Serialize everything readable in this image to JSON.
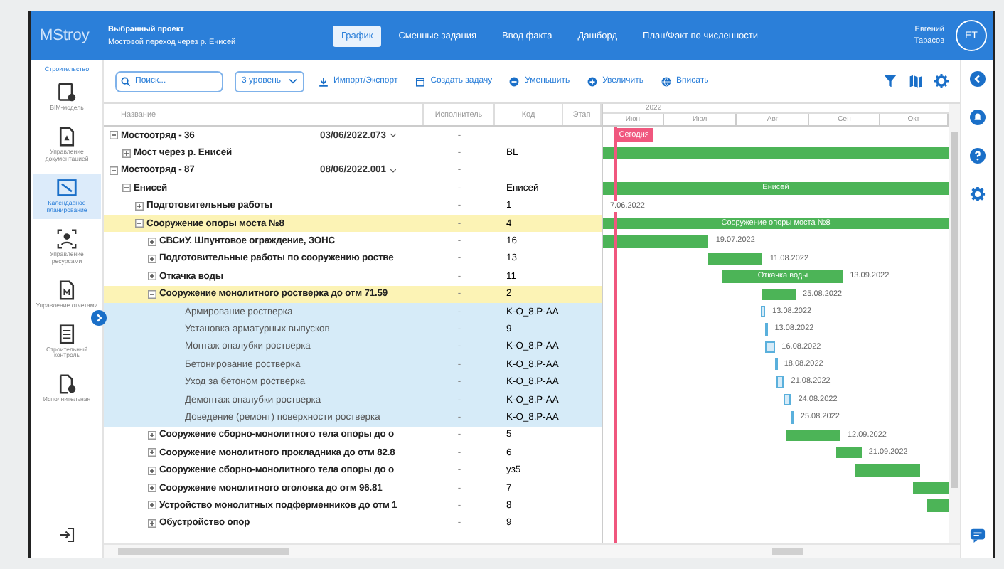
{
  "header": {
    "logo": "MStroy",
    "project_caption": "Выбранный проект",
    "project_name": "Мостовой переход через р. Енисей",
    "tabs": [
      {
        "label": "График",
        "selected": true
      },
      {
        "label": "Сменные задания",
        "selected": false
      },
      {
        "label": "Ввод факта",
        "selected": false
      },
      {
        "label": "Дашборд",
        "selected": false
      },
      {
        "label": "План/Факт по численности",
        "selected": false
      }
    ],
    "user_first": "Евгений",
    "user_last": "Тарасов",
    "avatar": "ET"
  },
  "sidebar": {
    "caption": "Строительство",
    "items": [
      {
        "kind": "model",
        "label": "BIM-модель",
        "selected": false
      },
      {
        "kind": "document",
        "label": "Управление документацией",
        "selected": false
      },
      {
        "kind": "schedule",
        "label": "Календарное планирование",
        "selected": true
      },
      {
        "kind": "resources",
        "label": "Управление ресурсами",
        "selected": false
      },
      {
        "kind": "report",
        "label": "Управление отчетами",
        "selected": false
      },
      {
        "kind": "control",
        "label": "Строительный контроль",
        "selected": false
      },
      {
        "kind": "executive",
        "label": "Исполнительная",
        "selected": false
      }
    ]
  },
  "toolbar": {
    "search": {
      "placeholder": "Поиск..."
    },
    "level_select": "3 уровень",
    "buttons": [
      {
        "kind": "import",
        "label": "Импорт/Экспорт"
      },
      {
        "kind": "create",
        "label": "Создать задачу"
      },
      {
        "kind": "zoom_out",
        "label": "Уменьшить"
      },
      {
        "kind": "zoom_in",
        "label": "Увеличить"
      },
      {
        "kind": "fit",
        "label": "Вписать"
      }
    ]
  },
  "table": {
    "columns": [
      "Название",
      "Исполнитель",
      "Код",
      "Этап"
    ],
    "rows": [
      {
        "name": "Мостоотряд - 36",
        "version": "03/06/2022.073",
        "kind": "group",
        "expanded": true,
        "executor": "-",
        "marked": false,
        "selected": false,
        "children": [
          {
            "name": "Мост через р. Енисей",
            "kind": "group",
            "expanded": false,
            "executor": "-",
            "code": "BL",
            "marked": false,
            "selected": false
          }
        ]
      },
      {
        "name": "Мостоотряд - 87",
        "version": "08/06/2022.001",
        "kind": "group",
        "expanded": true,
        "executor": "-",
        "marked": false,
        "selected": false,
        "children": [
          {
            "name": "Енисей",
            "kind": "group",
            "expanded": true,
            "executor": "-",
            "code": "Енисей",
            "marked": false,
            "selected": false,
            "bar_label": "Енисей",
            "children": [
              {
                "name": "Подготовительные работы",
                "kind": "group",
                "expanded": false,
                "executor": "-",
                "code": "1",
                "marked": false,
                "selected": false,
                "end_date": "7.06.2022"
              },
              {
                "name": "Сооружение опоры моста №8",
                "kind": "group",
                "expanded": true,
                "executor": "-",
                "code": "4",
                "marked": true,
                "selected": false,
                "bar_label": "Сооружение опоры моста №8",
                "children": [
                  {
                    "name": "СВСиУ. Шпунтовое ограждение, ЗОНС",
                    "kind": "group",
                    "expanded": false,
                    "executor": "-",
                    "code": "16",
                    "marked": false,
                    "selected": false,
                    "end_date": "19.07.2022"
                  },
                  {
                    "name": "Подготовительные работы по сооружению ростве",
                    "kind": "group",
                    "expanded": false,
                    "executor": "-",
                    "code": "13",
                    "marked": false,
                    "selected": false,
                    "end_date": "11.08.2022"
                  },
                  {
                    "name": "Откачка воды",
                    "kind": "group",
                    "expanded": false,
                    "executor": "-",
                    "code": "11",
                    "marked": false,
                    "selected": false,
                    "bar_label": "Откачка воды",
                    "end_date": "13.09.2022"
                  },
                  {
                    "name": "Сооружение монолитного ростверка до отм 71.59",
                    "kind": "group",
                    "expanded": true,
                    "executor": "-",
                    "code": "2",
                    "marked": true,
                    "selected": false,
                    "end_date": "25.08.2022",
                    "children": [
                      {
                        "name": "Армирование ростверка",
                        "kind": "task",
                        "executor": "-",
                        "code": "K-O_8.P-AA",
                        "marked": false,
                        "selected": true,
                        "end_date": "13.08.2022"
                      },
                      {
                        "name": "Установка арматурных выпусков",
                        "kind": "task",
                        "executor": "-",
                        "code": "9",
                        "marked": false,
                        "selected": true,
                        "end_date": "13.08.2022"
                      },
                      {
                        "name": "Монтаж опалубки ростверка",
                        "kind": "task",
                        "executor": "-",
                        "code": "K-O_8.P-AA",
                        "marked": false,
                        "selected": true,
                        "end_date": "16.08.2022"
                      },
                      {
                        "name": "Бетонирование ростверка",
                        "kind": "task",
                        "executor": "-",
                        "code": "K-O_8.P-AA",
                        "marked": false,
                        "selected": true,
                        "end_date": "18.08.2022"
                      },
                      {
                        "name": "Уход за бетоном ростверка",
                        "kind": "task",
                        "executor": "-",
                        "code": "K-O_8.P-AA",
                        "marked": false,
                        "selected": true,
                        "end_date": "21.08.2022"
                      },
                      {
                        "name": "Демонтаж опалубки ростверка",
                        "kind": "task",
                        "executor": "-",
                        "code": "K-O_8.P-AA",
                        "marked": false,
                        "selected": true,
                        "end_date": "24.08.2022"
                      },
                      {
                        "name": "Доведение (ремонт) поверхности ростверка",
                        "kind": "task",
                        "executor": "-",
                        "code": "K-O_8.P-AA",
                        "marked": false,
                        "selected": true,
                        "end_date": "25.08.2022"
                      }
                    ]
                  },
                  {
                    "name": "Сооружение сборно-монолитного тела опоры до о",
                    "kind": "group",
                    "expanded": false,
                    "executor": "-",
                    "code": "5",
                    "marked": false,
                    "selected": false,
                    "end_date": "12.09.2022"
                  },
                  {
                    "name": "Сооружение монолитного прокладника до отм 82.8",
                    "kind": "group",
                    "expanded": false,
                    "executor": "-",
                    "code": "6",
                    "marked": false,
                    "selected": false,
                    "end_date": "21.09.2022"
                  },
                  {
                    "name": "Сооружение сборно-монолитного тела опоры до о",
                    "kind": "group",
                    "expanded": false,
                    "executor": "-",
                    "code": "уз5",
                    "marked": false,
                    "selected": false
                  },
                  {
                    "name": "Сооружение монолитного оголовка до отм 96.81",
                    "kind": "group",
                    "expanded": false,
                    "executor": "-",
                    "code": "7",
                    "marked": false,
                    "selected": false
                  },
                  {
                    "name": "Устройство монолитных подферменников до отм 1",
                    "kind": "group",
                    "expanded": false,
                    "executor": "-",
                    "code": "8",
                    "marked": false,
                    "selected": false
                  },
                  {
                    "name": "Обустройство опор",
                    "kind": "group",
                    "expanded": false,
                    "executor": "-",
                    "code": "9",
                    "marked": false,
                    "selected": false
                  }
                ]
              }
            ]
          }
        ]
      }
    ]
  },
  "gantt": {
    "year": "2022",
    "months": [
      "Июн",
      "Июл",
      "Авг",
      "Сен",
      "Окт"
    ],
    "today_label": "Сегодня"
  }
}
